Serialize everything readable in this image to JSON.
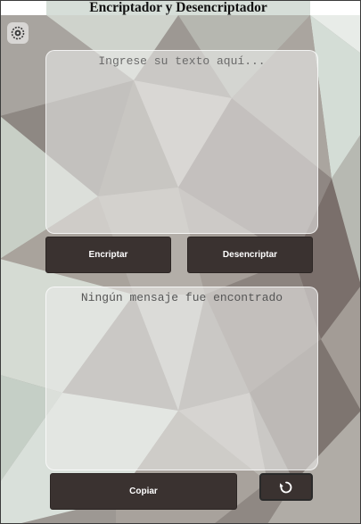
{
  "header": {
    "title": "Encriptador y Desencriptador"
  },
  "logo": {
    "icon": "gear-head-logo-icon"
  },
  "input": {
    "placeholder": "Ingrese su texto aquí...",
    "value": ""
  },
  "actions": {
    "encrypt_label": "Encriptar",
    "decrypt_label": "Desencriptar"
  },
  "output": {
    "empty_message": "Ningún mensaje fue encontrado"
  },
  "footer": {
    "copy_label": "Copiar",
    "reset_icon": "refresh-icon"
  },
  "colors": {
    "button_bg": "#3a3230",
    "button_text": "#ffffff",
    "panel_bg": "rgba(235,235,232,0.58)"
  }
}
